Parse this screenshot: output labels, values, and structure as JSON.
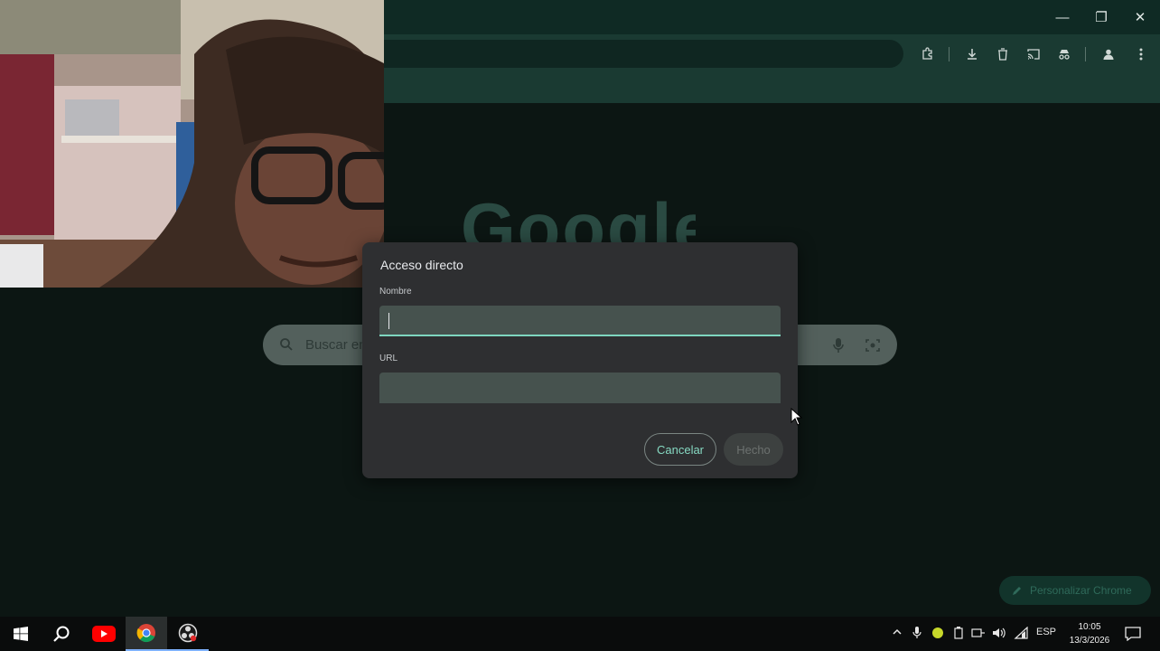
{
  "browser": {
    "window_controls": {
      "minimize": "—",
      "restore": "❐",
      "close": "✕"
    },
    "toolbar_icons": [
      "extensions-icon",
      "download-icon",
      "trash-icon",
      "cast-icon",
      "incognito-icon",
      "profile-icon",
      "menu-icon"
    ]
  },
  "newtab": {
    "logo_text": "Google",
    "search_placeholder": "Buscar en",
    "customize_label": "Personalizar Chrome"
  },
  "dialog": {
    "title": "Acceso directo",
    "name_label": "Nombre",
    "name_value": "",
    "url_label": "URL",
    "url_value": "",
    "cancel_label": "Cancelar",
    "done_label": "Hecho"
  },
  "taskbar": {
    "apps": [
      "windows-start-icon",
      "search-icon",
      "youtube-icon",
      "chrome-icon",
      "obs-icon"
    ],
    "language": "ESP",
    "time": "10:05",
    "date": "13/3/2026"
  },
  "colors": {
    "accent": "#7ed6bf",
    "toolbar": "#1a3a32",
    "page_bg": "#0c1613",
    "dialog_bg": "#2e2f31"
  }
}
